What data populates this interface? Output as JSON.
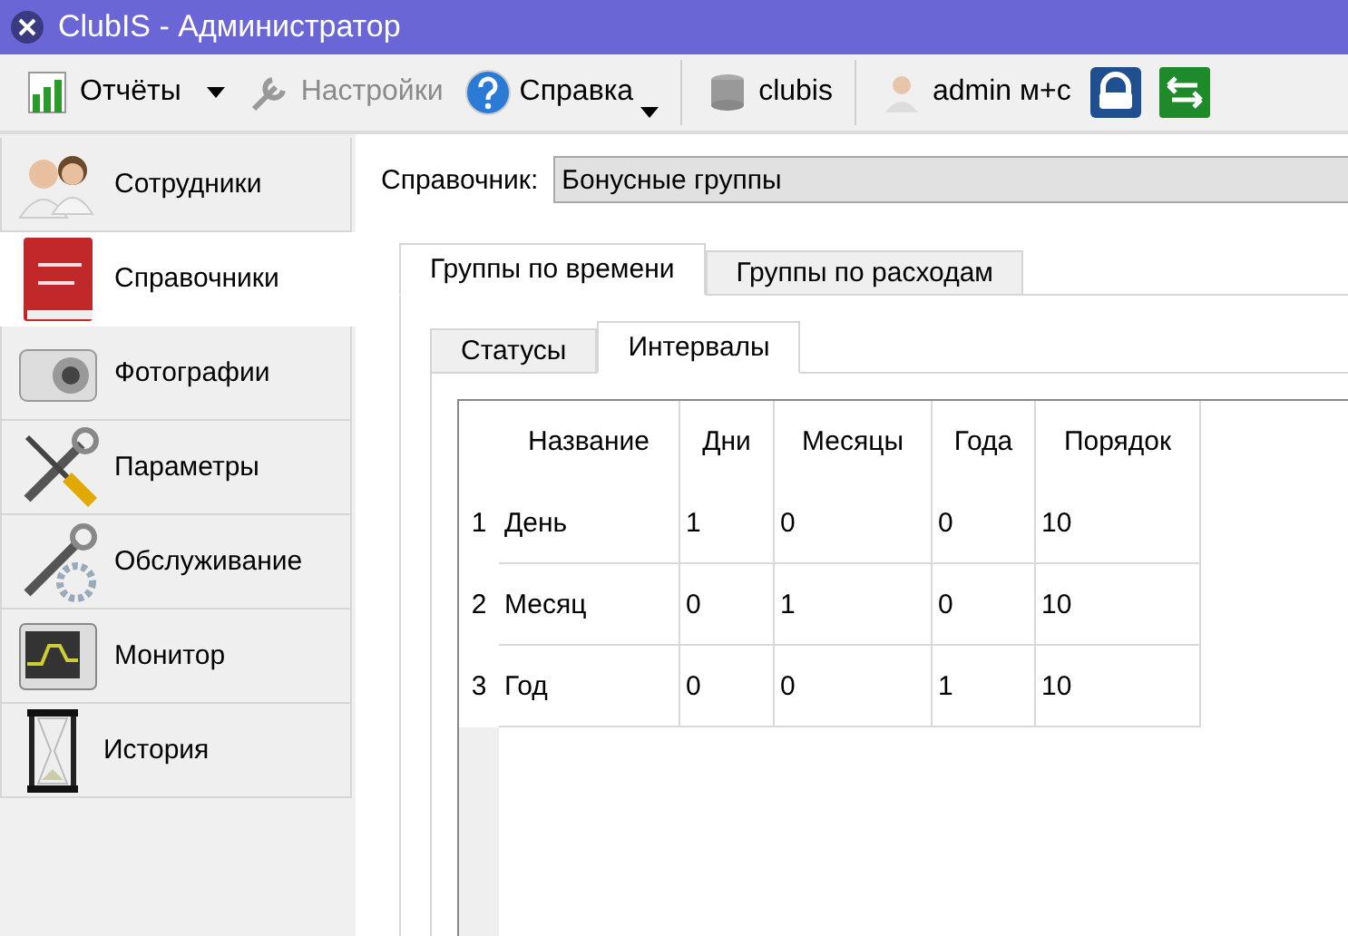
{
  "window": {
    "title": "ClubIS - Администратор"
  },
  "toolbar": [
    {
      "kind": "reports",
      "label": "Отчёты",
      "disabled": false,
      "has_menu": true
    },
    {
      "kind": "settings",
      "label": "Настройки",
      "disabled": true,
      "has_menu": false
    },
    {
      "kind": "help",
      "label": "Справка",
      "disabled": false,
      "has_menu": true
    },
    {
      "kind": "separator"
    },
    {
      "kind": "database",
      "label": "clubis",
      "disabled": false,
      "has_menu": false
    },
    {
      "kind": "separator"
    },
    {
      "kind": "user",
      "label": "admin м+с",
      "disabled": false,
      "has_menu": false
    },
    {
      "kind": "lock"
    },
    {
      "kind": "exchange"
    }
  ],
  "sidebar": {
    "items": [
      {
        "kind": "people",
        "label": "Сотрудники",
        "selected": false
      },
      {
        "kind": "book",
        "label": "Справочники",
        "selected": true
      },
      {
        "kind": "camera",
        "label": "Фотографии",
        "selected": false
      },
      {
        "kind": "tools",
        "label": "Параметры",
        "selected": false
      },
      {
        "kind": "service",
        "label": "Обслуживание",
        "selected": false
      },
      {
        "kind": "monitor",
        "label": "Монитор",
        "selected": false
      },
      {
        "kind": "hourglass",
        "label": "История",
        "selected": false
      }
    ]
  },
  "directory": {
    "label": "Справочник:",
    "value": "Бонусные группы"
  },
  "tabs": [
    {
      "label": "Группы по времени",
      "selected": true
    },
    {
      "label": "Группы по расходам",
      "selected": false
    }
  ],
  "subtabs": [
    {
      "label": "Статусы",
      "selected": false
    },
    {
      "label": "Интервалы",
      "selected": true
    }
  ],
  "table": {
    "columns": [
      "Название",
      "Дни",
      "Месяцы",
      "Года",
      "Порядок"
    ],
    "rows": [
      {
        "number": "1",
        "cells": [
          "День",
          "1",
          "0",
          "0",
          "10"
        ]
      },
      {
        "number": "2",
        "cells": [
          "Месяц",
          "0",
          "1",
          "0",
          "10"
        ]
      },
      {
        "number": "3",
        "cells": [
          "Год",
          "0",
          "0",
          "1",
          "10"
        ]
      }
    ]
  }
}
